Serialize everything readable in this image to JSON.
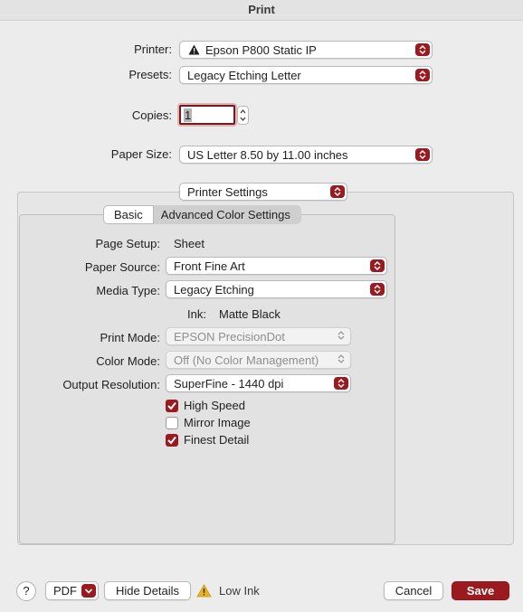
{
  "window": {
    "title": "Print"
  },
  "printer": {
    "label": "Printer:",
    "value": "Epson P800 Static IP",
    "icon": "warning-icon"
  },
  "presets": {
    "label": "Presets:",
    "value": "Legacy Etching Letter"
  },
  "copies": {
    "label": "Copies:",
    "value": "1"
  },
  "paper_size": {
    "label": "Paper Size:",
    "value": "US Letter 8.50 by 11.00 inches"
  },
  "section_menu": {
    "value": "Printer Settings"
  },
  "tabs": {
    "basic": "Basic",
    "advanced": "Advanced Color Settings"
  },
  "settings": {
    "page_setup": {
      "label": "Page Setup:",
      "value": "Sheet"
    },
    "paper_source": {
      "label": "Paper Source:",
      "value": "Front Fine Art"
    },
    "media_type": {
      "label": "Media Type:",
      "value": "Legacy Etching"
    },
    "ink": {
      "label": "Ink:",
      "value": "Matte Black"
    },
    "print_mode": {
      "label": "Print Mode:",
      "value": "EPSON PrecisionDot"
    },
    "color_mode": {
      "label": "Color Mode:",
      "value": "Off (No Color Management)"
    },
    "output_resolution": {
      "label": "Output Resolution:",
      "value": "SuperFine - 1440 dpi"
    },
    "high_speed": {
      "label": "High Speed",
      "checked": true
    },
    "mirror_image": {
      "label": "Mirror Image",
      "checked": false
    },
    "finest_detail": {
      "label": "Finest Detail",
      "checked": true
    }
  },
  "footer": {
    "help": "?",
    "pdf": "PDF",
    "hide_details": "Hide Details",
    "status": "Low Ink",
    "cancel": "Cancel",
    "save": "Save"
  },
  "colors": {
    "accent": "#9b1a1f",
    "background": "#ececec"
  }
}
